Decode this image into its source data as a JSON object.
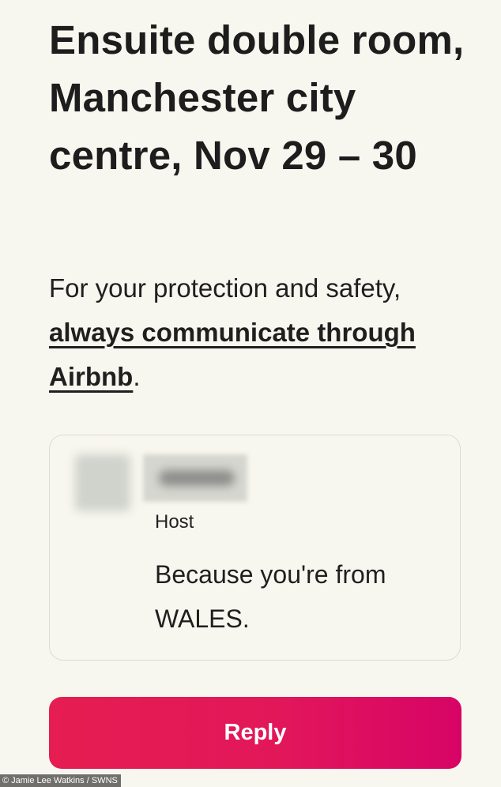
{
  "listing": {
    "title": "Ensuite double room, Manchester city centre, Nov 29 – 30"
  },
  "notice": {
    "prefix": "For your protection and safety,",
    "link_label": "always communicate through Airbnb",
    "suffix": "."
  },
  "message_card": {
    "role": "Host",
    "text": "Because you're from WALES."
  },
  "actions": {
    "reply_label": "Reply"
  },
  "credit": "© Jamie Lee Watkins / SWNS",
  "colors": {
    "background": "#f8f7ef",
    "reply_start": "#e51d51",
    "reply_end": "#d70466"
  }
}
